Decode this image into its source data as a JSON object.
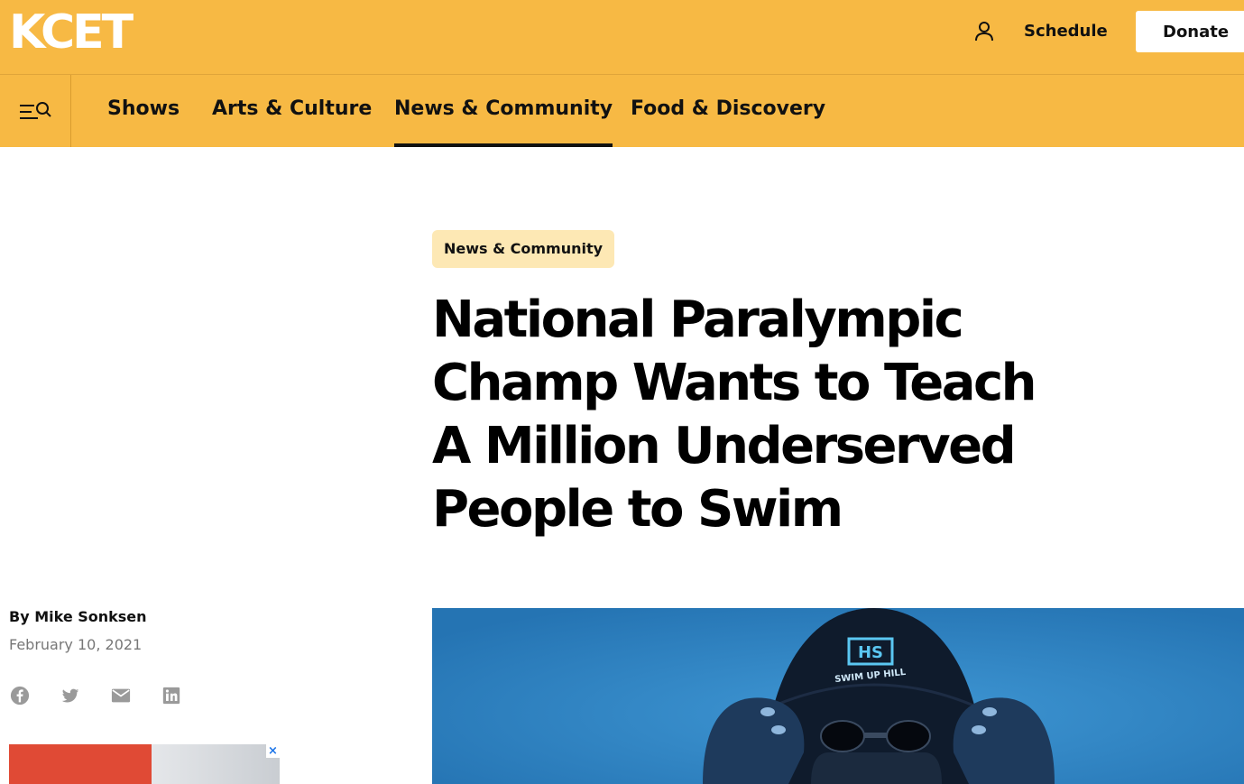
{
  "header": {
    "logo": "KCET",
    "schedule_label": "Schedule",
    "donate_label": "Donate"
  },
  "nav": {
    "items": [
      {
        "label": "Shows"
      },
      {
        "label": "Arts & Culture"
      },
      {
        "label": "News & Community",
        "active": true
      },
      {
        "label": "Food & Discovery"
      }
    ]
  },
  "article": {
    "category": "News & Community",
    "title": "National Paralympic Champ Wants to Teach A Million Underserved People to Swim",
    "byline": "By Mike Sonksen",
    "date": "February 10, 2021",
    "share_icons": [
      "facebook-icon",
      "twitter-icon",
      "email-icon",
      "linkedin-icon"
    ],
    "hero_cap_text": "SWIM UP HILL"
  },
  "ad": {
    "close_glyph": "×"
  },
  "colors": {
    "brand_yellow": "#f7b944",
    "pill_bg": "#fde8b4",
    "hero_blue": "#2f82c1"
  }
}
